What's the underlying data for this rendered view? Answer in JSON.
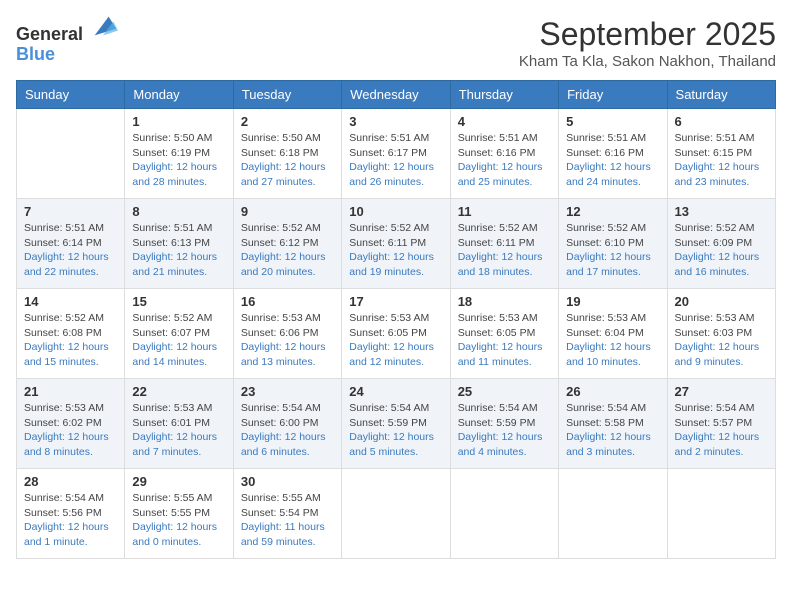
{
  "header": {
    "logo_general": "General",
    "logo_blue": "Blue",
    "month_title": "September 2025",
    "subtitle": "Kham Ta Kla, Sakon Nakhon, Thailand"
  },
  "weekdays": [
    "Sunday",
    "Monday",
    "Tuesday",
    "Wednesday",
    "Thursday",
    "Friday",
    "Saturday"
  ],
  "weeks": [
    [
      {
        "day": "",
        "sunrise": "",
        "sunset": "",
        "daylight": ""
      },
      {
        "day": "1",
        "sunrise": "Sunrise: 5:50 AM",
        "sunset": "Sunset: 6:19 PM",
        "daylight": "Daylight: 12 hours and 28 minutes."
      },
      {
        "day": "2",
        "sunrise": "Sunrise: 5:50 AM",
        "sunset": "Sunset: 6:18 PM",
        "daylight": "Daylight: 12 hours and 27 minutes."
      },
      {
        "day": "3",
        "sunrise": "Sunrise: 5:51 AM",
        "sunset": "Sunset: 6:17 PM",
        "daylight": "Daylight: 12 hours and 26 minutes."
      },
      {
        "day": "4",
        "sunrise": "Sunrise: 5:51 AM",
        "sunset": "Sunset: 6:16 PM",
        "daylight": "Daylight: 12 hours and 25 minutes."
      },
      {
        "day": "5",
        "sunrise": "Sunrise: 5:51 AM",
        "sunset": "Sunset: 6:16 PM",
        "daylight": "Daylight: 12 hours and 24 minutes."
      },
      {
        "day": "6",
        "sunrise": "Sunrise: 5:51 AM",
        "sunset": "Sunset: 6:15 PM",
        "daylight": "Daylight: 12 hours and 23 minutes."
      }
    ],
    [
      {
        "day": "7",
        "sunrise": "Sunrise: 5:51 AM",
        "sunset": "Sunset: 6:14 PM",
        "daylight": "Daylight: 12 hours and 22 minutes."
      },
      {
        "day": "8",
        "sunrise": "Sunrise: 5:51 AM",
        "sunset": "Sunset: 6:13 PM",
        "daylight": "Daylight: 12 hours and 21 minutes."
      },
      {
        "day": "9",
        "sunrise": "Sunrise: 5:52 AM",
        "sunset": "Sunset: 6:12 PM",
        "daylight": "Daylight: 12 hours and 20 minutes."
      },
      {
        "day": "10",
        "sunrise": "Sunrise: 5:52 AM",
        "sunset": "Sunset: 6:11 PM",
        "daylight": "Daylight: 12 hours and 19 minutes."
      },
      {
        "day": "11",
        "sunrise": "Sunrise: 5:52 AM",
        "sunset": "Sunset: 6:11 PM",
        "daylight": "Daylight: 12 hours and 18 minutes."
      },
      {
        "day": "12",
        "sunrise": "Sunrise: 5:52 AM",
        "sunset": "Sunset: 6:10 PM",
        "daylight": "Daylight: 12 hours and 17 minutes."
      },
      {
        "day": "13",
        "sunrise": "Sunrise: 5:52 AM",
        "sunset": "Sunset: 6:09 PM",
        "daylight": "Daylight: 12 hours and 16 minutes."
      }
    ],
    [
      {
        "day": "14",
        "sunrise": "Sunrise: 5:52 AM",
        "sunset": "Sunset: 6:08 PM",
        "daylight": "Daylight: 12 hours and 15 minutes."
      },
      {
        "day": "15",
        "sunrise": "Sunrise: 5:52 AM",
        "sunset": "Sunset: 6:07 PM",
        "daylight": "Daylight: 12 hours and 14 minutes."
      },
      {
        "day": "16",
        "sunrise": "Sunrise: 5:53 AM",
        "sunset": "Sunset: 6:06 PM",
        "daylight": "Daylight: 12 hours and 13 minutes."
      },
      {
        "day": "17",
        "sunrise": "Sunrise: 5:53 AM",
        "sunset": "Sunset: 6:05 PM",
        "daylight": "Daylight: 12 hours and 12 minutes."
      },
      {
        "day": "18",
        "sunrise": "Sunrise: 5:53 AM",
        "sunset": "Sunset: 6:05 PM",
        "daylight": "Daylight: 12 hours and 11 minutes."
      },
      {
        "day": "19",
        "sunrise": "Sunrise: 5:53 AM",
        "sunset": "Sunset: 6:04 PM",
        "daylight": "Daylight: 12 hours and 10 minutes."
      },
      {
        "day": "20",
        "sunrise": "Sunrise: 5:53 AM",
        "sunset": "Sunset: 6:03 PM",
        "daylight": "Daylight: 12 hours and 9 minutes."
      }
    ],
    [
      {
        "day": "21",
        "sunrise": "Sunrise: 5:53 AM",
        "sunset": "Sunset: 6:02 PM",
        "daylight": "Daylight: 12 hours and 8 minutes."
      },
      {
        "day": "22",
        "sunrise": "Sunrise: 5:53 AM",
        "sunset": "Sunset: 6:01 PM",
        "daylight": "Daylight: 12 hours and 7 minutes."
      },
      {
        "day": "23",
        "sunrise": "Sunrise: 5:54 AM",
        "sunset": "Sunset: 6:00 PM",
        "daylight": "Daylight: 12 hours and 6 minutes."
      },
      {
        "day": "24",
        "sunrise": "Sunrise: 5:54 AM",
        "sunset": "Sunset: 5:59 PM",
        "daylight": "Daylight: 12 hours and 5 minutes."
      },
      {
        "day": "25",
        "sunrise": "Sunrise: 5:54 AM",
        "sunset": "Sunset: 5:59 PM",
        "daylight": "Daylight: 12 hours and 4 minutes."
      },
      {
        "day": "26",
        "sunrise": "Sunrise: 5:54 AM",
        "sunset": "Sunset: 5:58 PM",
        "daylight": "Daylight: 12 hours and 3 minutes."
      },
      {
        "day": "27",
        "sunrise": "Sunrise: 5:54 AM",
        "sunset": "Sunset: 5:57 PM",
        "daylight": "Daylight: 12 hours and 2 minutes."
      }
    ],
    [
      {
        "day": "28",
        "sunrise": "Sunrise: 5:54 AM",
        "sunset": "Sunset: 5:56 PM",
        "daylight": "Daylight: 12 hours and 1 minute."
      },
      {
        "day": "29",
        "sunrise": "Sunrise: 5:55 AM",
        "sunset": "Sunset: 5:55 PM",
        "daylight": "Daylight: 12 hours and 0 minutes."
      },
      {
        "day": "30",
        "sunrise": "Sunrise: 5:55 AM",
        "sunset": "Sunset: 5:54 PM",
        "daylight": "Daylight: 11 hours and 59 minutes."
      },
      {
        "day": "",
        "sunrise": "",
        "sunset": "",
        "daylight": ""
      },
      {
        "day": "",
        "sunrise": "",
        "sunset": "",
        "daylight": ""
      },
      {
        "day": "",
        "sunrise": "",
        "sunset": "",
        "daylight": ""
      },
      {
        "day": "",
        "sunrise": "",
        "sunset": "",
        "daylight": ""
      }
    ]
  ]
}
